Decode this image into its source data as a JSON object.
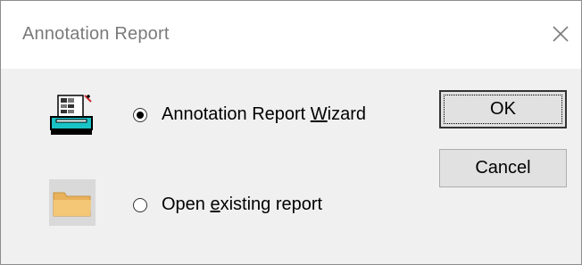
{
  "window": {
    "title": "Annotation Report",
    "close_icon": "close-icon"
  },
  "options": [
    {
      "label_before": "Annotation Report ",
      "label_mnemonic": "W",
      "label_after": "izard",
      "selected": true,
      "icon": "report-wizard-icon"
    },
    {
      "label_before": "Open ",
      "label_mnemonic": "e",
      "label_after": "xisting report",
      "selected": false,
      "icon": "folder-icon"
    }
  ],
  "buttons": {
    "ok_label": "OK",
    "cancel_label": "Cancel"
  },
  "colors": {
    "dialog_bg": "#f0f0f0",
    "title_bg": "#ffffff",
    "title_text": "#7a7a7a",
    "button_bg": "#e1e1e1",
    "folder": "#f3c776",
    "wizard_accent": "#19c3c6"
  }
}
